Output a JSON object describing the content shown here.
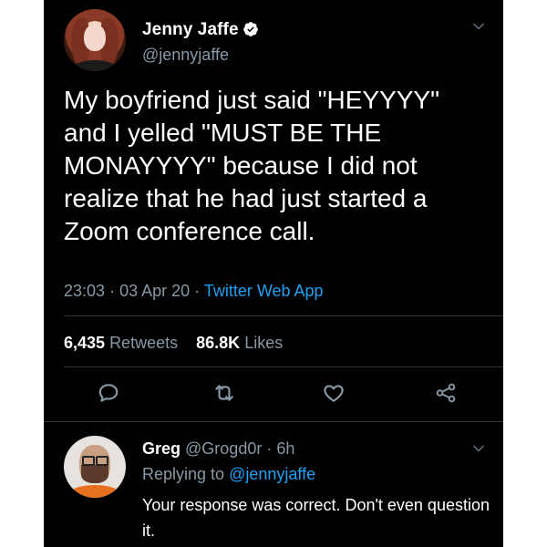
{
  "tweet": {
    "author_name": "Jenny Jaffe",
    "author_handle": "@jennyjaffe",
    "text": "My boyfriend just said \"HEYYYY\"\nand I yelled \"MUST BE THE\nMONAYYYY\" because I did not\nrealize that he had just started a\nZoom conference call.",
    "time": "23:03",
    "date": "03 Apr 20",
    "separator": "·",
    "source": "Twitter Web App",
    "retweets_count": "6,435",
    "retweets_label": "Retweets",
    "likes_count": "86.8K",
    "likes_label": "Likes"
  },
  "reply": {
    "author_name": "Greg",
    "author_handle": "@Grogd0r",
    "separator": "·",
    "age": "6h",
    "replying_label": "Replying to",
    "replying_to": "@jennyjaffe",
    "text": "Your response was correct.  Don't even question it."
  },
  "icons": {
    "verified": "verified-badge-icon",
    "more": "chevron-down-icon",
    "reply": "reply-bubble-icon",
    "retweet": "retweet-icon",
    "like": "heart-icon",
    "share": "share-icon"
  },
  "colors": {
    "background": "#000000",
    "text": "#ffffff",
    "secondary": "#8899a6",
    "accent": "#1da1f2"
  }
}
